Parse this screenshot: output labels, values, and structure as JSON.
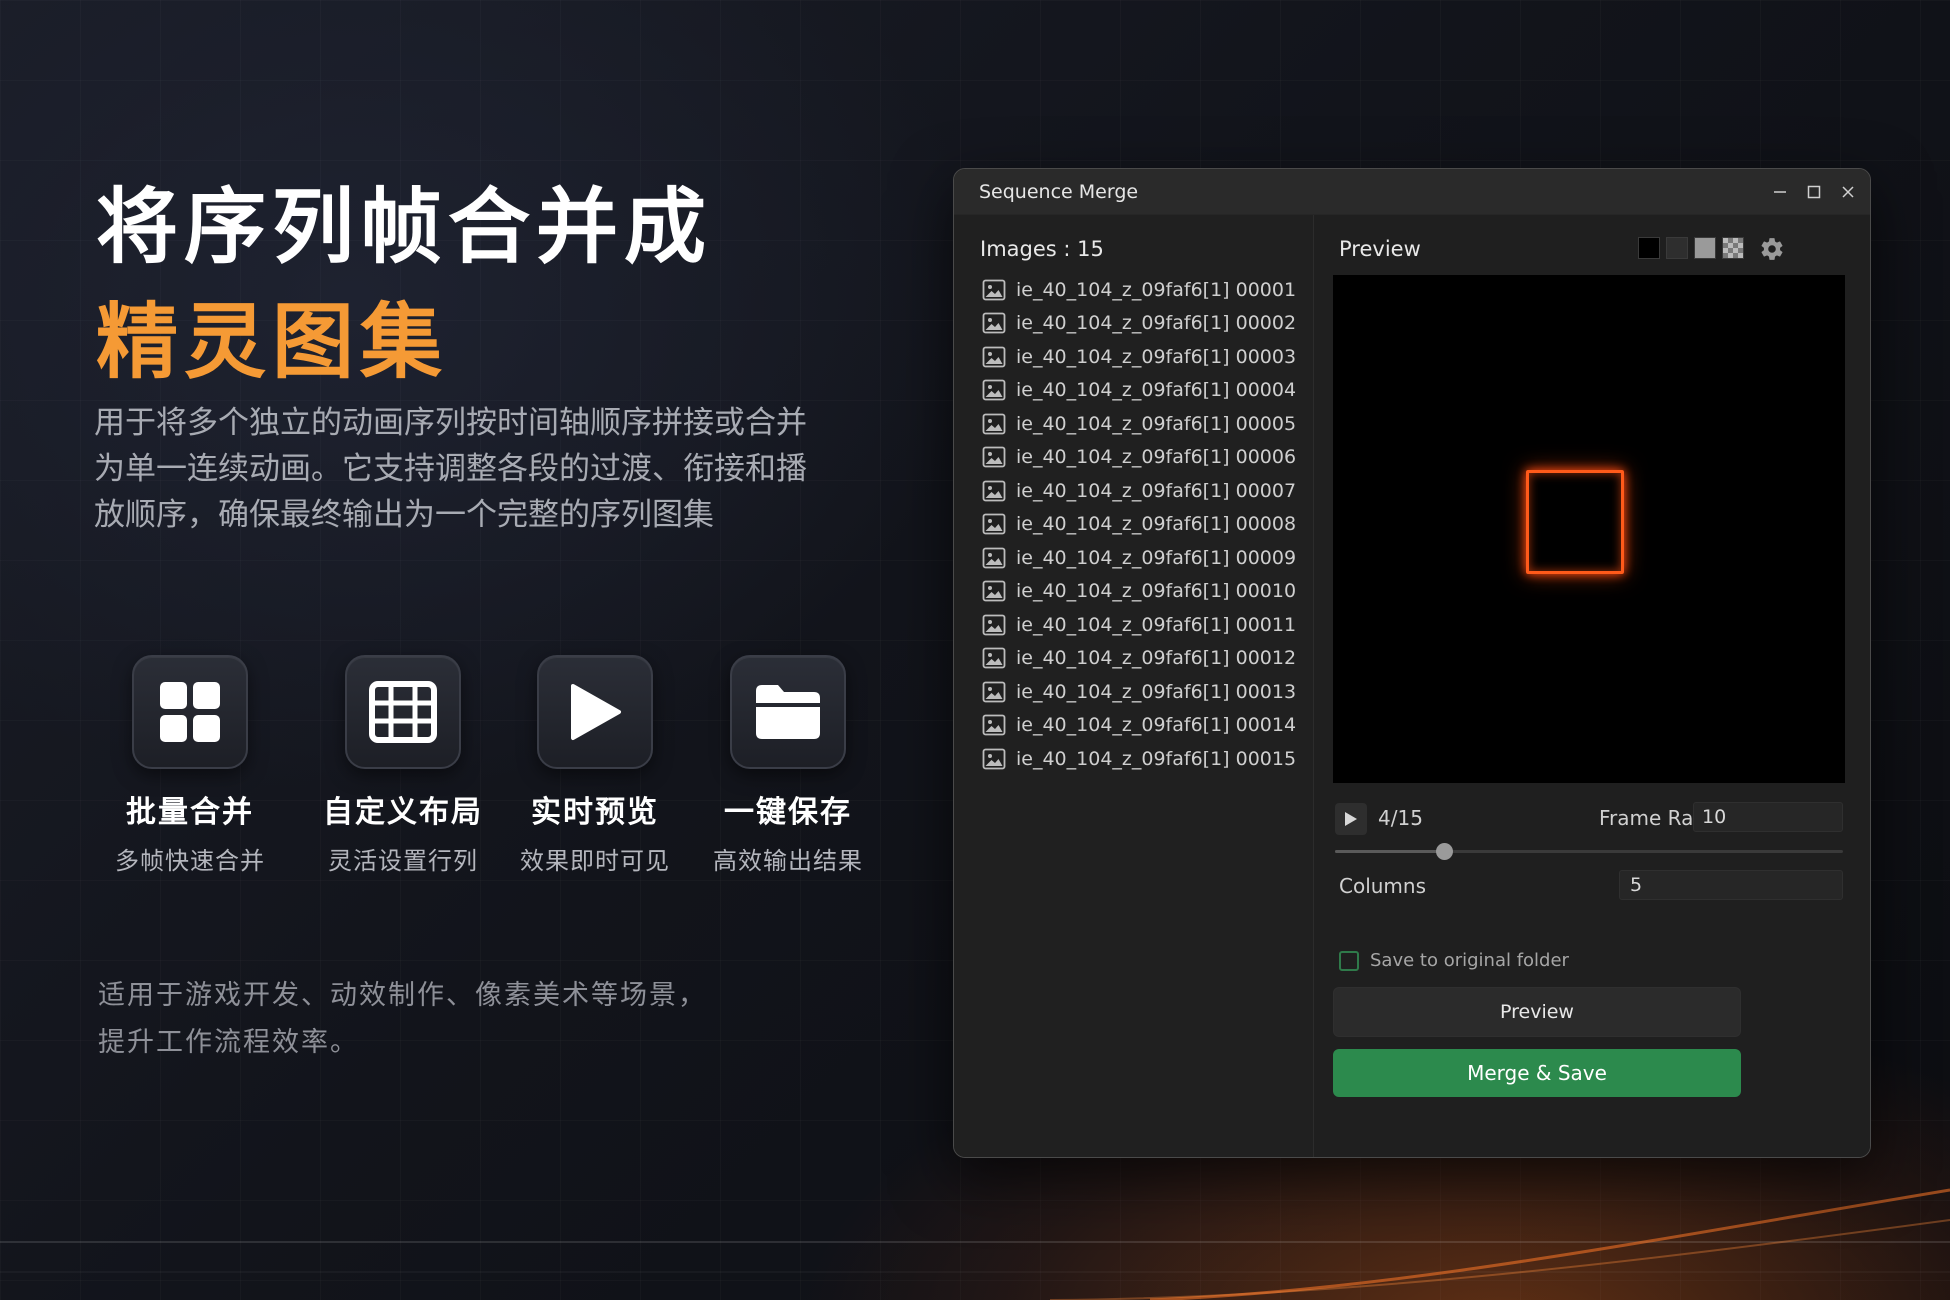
{
  "hero": {
    "headline_line1": "将序列帧合并成",
    "headline_line2": "精灵图集",
    "description": "用于将多个独立的动画序列按时间轴顺序拼接或合并为单一连续动画。它支持调整各段的过渡、衔接和播放顺序，确保最终输出为一个完整的序列图集",
    "accent_color": "#f59a35"
  },
  "features": [
    {
      "icon": "grid-2x2-icon",
      "title": "批量合并",
      "subtitle": "多帧快速合并"
    },
    {
      "icon": "grid-layout-icon",
      "title": "自定义布局",
      "subtitle": "灵活设置行列"
    },
    {
      "icon": "play-icon",
      "title": "实时预览",
      "subtitle": "效果即时可见"
    },
    {
      "icon": "folder-icon",
      "title": "一键保存",
      "subtitle": "高效输出结果"
    }
  ],
  "note": {
    "line1": "适用于游戏开发、动效制作、像素美术等场景，",
    "line2": "提升工作流程效率。"
  },
  "window": {
    "title": "Sequence Merge",
    "controls": [
      "minimize-icon",
      "maximize-icon",
      "close-icon"
    ]
  },
  "images": {
    "count_label": "Images : 15",
    "files": [
      "ie_40_104_z_09faf6[1] 00001",
      "ie_40_104_z_09faf6[1] 00002",
      "ie_40_104_z_09faf6[1] 00003",
      "ie_40_104_z_09faf6[1] 00004",
      "ie_40_104_z_09faf6[1] 00005",
      "ie_40_104_z_09faf6[1] 00006",
      "ie_40_104_z_09faf6[1] 00007",
      "ie_40_104_z_09faf6[1] 00008",
      "ie_40_104_z_09faf6[1] 00009",
      "ie_40_104_z_09faf6[1] 00010",
      "ie_40_104_z_09faf6[1] 00011",
      "ie_40_104_z_09faf6[1] 00012",
      "ie_40_104_z_09faf6[1] 00013",
      "ie_40_104_z_09faf6[1] 00014",
      "ie_40_104_z_09faf6[1] 00015"
    ]
  },
  "preview": {
    "label": "Preview",
    "background_swatches": [
      "#000000",
      "#2e2e2e",
      "#9a9a9a",
      "checker"
    ],
    "frame_counter": "4/15",
    "current_frame": 4,
    "total_frames": 15,
    "frame_rate_label": "Frame Rate",
    "frame_rate_value": "10",
    "columns_label": "Columns",
    "columns_value": "5",
    "save_to_original_label": "Save to original folder",
    "save_to_original_checked": false,
    "preview_button": "Preview",
    "merge_button": "Merge & Save",
    "merge_button_color": "#2c8a4d"
  }
}
